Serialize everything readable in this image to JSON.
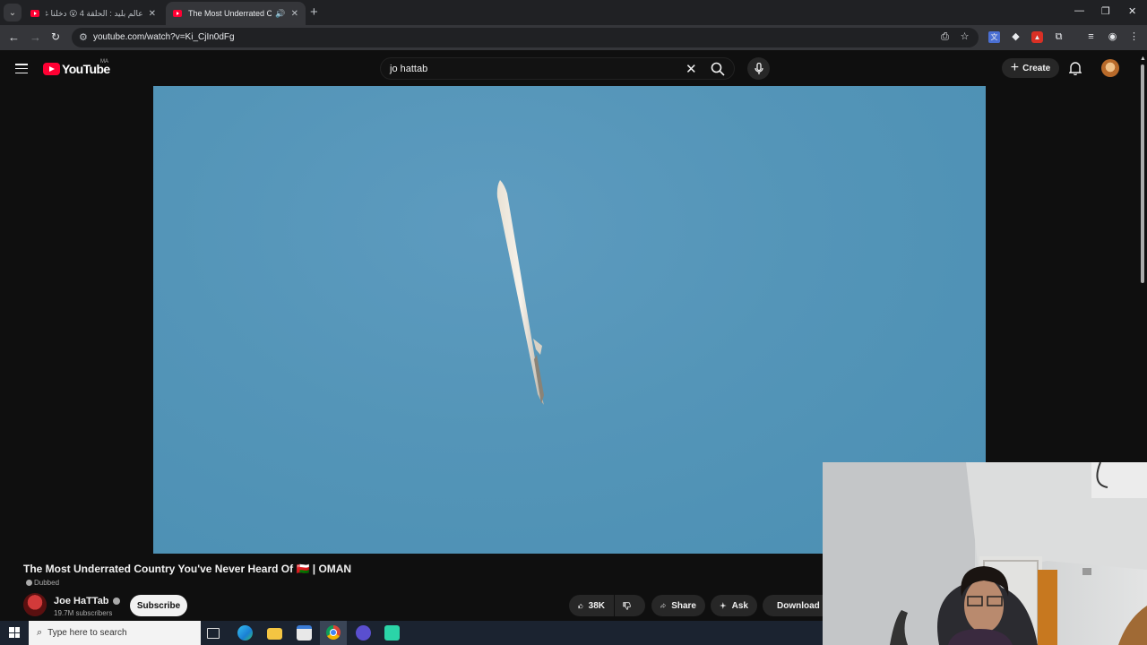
{
  "browser": {
    "tabs": [
      {
        "title": "عالم بليد : الحلقة 4 😮 دخلنا غرفة",
        "active": false
      },
      {
        "title": "The Most Underrated Coun",
        "active": true
      }
    ],
    "url": "youtube.com/watch?v=Ki_CjIn0dFg"
  },
  "header": {
    "logo_text": "YouTube",
    "country_code": "MA",
    "search_query": "jo hattab",
    "create_label": "Create"
  },
  "video": {
    "title": "The Most Underrated Country You've Never Heard Of 🇴🇲 | OMAN",
    "badge": "Dubbed",
    "channel_name": "Joe HaTTab",
    "subscribers": "19.7M subscribers",
    "subscribe_label": "Subscribe",
    "likes": "38K",
    "share_label": "Share",
    "ask_label": "Ask",
    "download_label": "Download"
  },
  "taskbar": {
    "search_placeholder": "Type here to search"
  },
  "colors": {
    "brand_red": "#ff0033",
    "sky": "#5495b8"
  }
}
